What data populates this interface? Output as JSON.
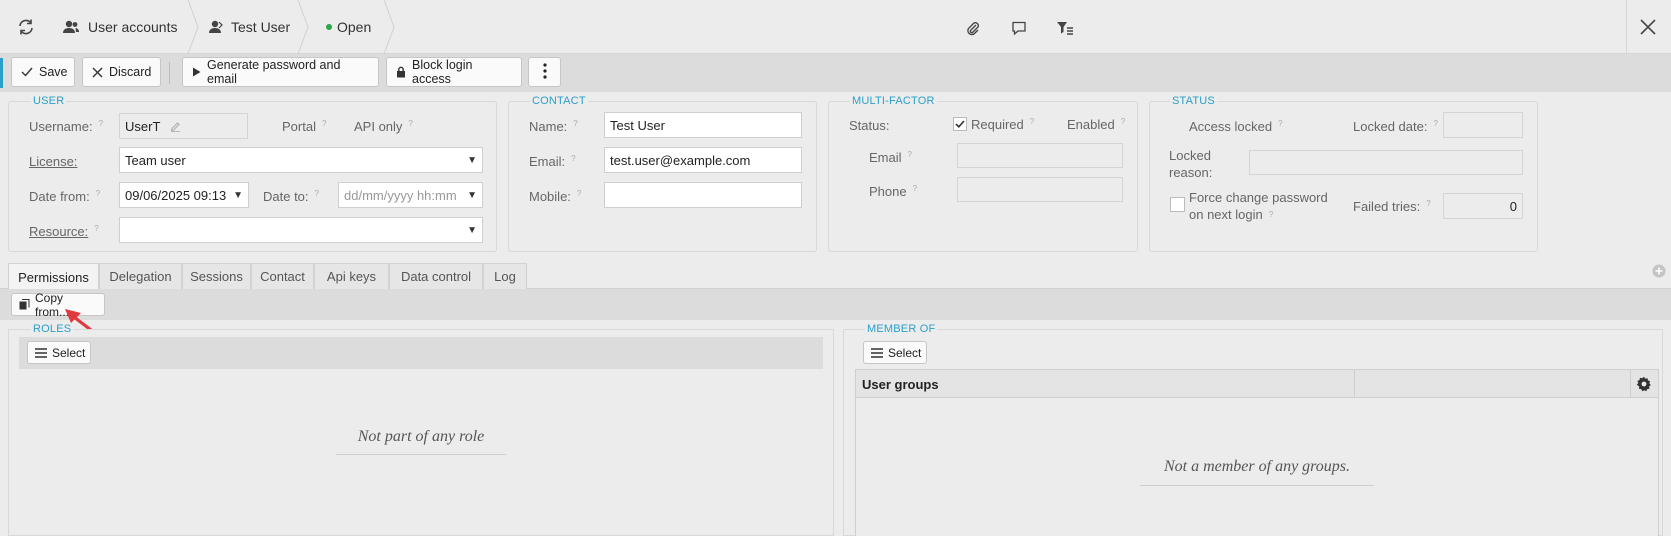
{
  "header": {
    "breadcrumbs": [
      {
        "label": "User accounts"
      },
      {
        "label": "Test User"
      },
      {
        "label": "Open"
      }
    ],
    "status_color": "#2aa845",
    "icons": [
      "refresh-icon",
      "user-accounts-icon",
      "user-icon",
      "status-dot-icon",
      "paperclip-icon",
      "comment-icon",
      "filter-list-icon",
      "close-icon"
    ]
  },
  "toolbar": {
    "save_label": "Save",
    "discard_label": "Discard",
    "generate_label": "Generate password and email",
    "block_label": "Block login access"
  },
  "user": {
    "title": "USER",
    "username_label": "Username:",
    "username_value": "UserT",
    "portal_label": "Portal",
    "api_only_label": "API only",
    "license_label": "License:",
    "license_value": "Team user",
    "date_from_label": "Date from:",
    "date_from_value": "09/06/2025 09:13",
    "date_to_label": "Date to:",
    "date_to_placeholder": "dd/mm/yyyy hh:mm",
    "resource_label": "Resource:",
    "resource_value": ""
  },
  "contact": {
    "title": "CONTACT",
    "name_label": "Name:",
    "name_value": "Test User",
    "email_label": "Email:",
    "email_value": "test.user@example.com",
    "mobile_label": "Mobile:",
    "mobile_value": ""
  },
  "mfa": {
    "title": "MULTI-FACTOR",
    "status_label": "Status:",
    "required_label": "Required",
    "required_checked": true,
    "enabled_label": "Enabled",
    "email_label": "Email",
    "phone_label": "Phone"
  },
  "status": {
    "title": "STATUS",
    "access_locked_label": "Access locked",
    "locked_date_label": "Locked date:",
    "locked_reason_label_1": "Locked",
    "locked_reason_label_2": "reason:",
    "force_change_label_1": "Force change password",
    "force_change_label_2": "on next login",
    "failed_tries_label": "Failed tries:",
    "failed_tries_value": "0"
  },
  "tabs": [
    {
      "label": "Permissions"
    },
    {
      "label": "Delegation"
    },
    {
      "label": "Sessions"
    },
    {
      "label": "Contact"
    },
    {
      "label": "Api keys"
    },
    {
      "label": "Data control"
    },
    {
      "label": "Log"
    }
  ],
  "permissions": {
    "copy_from_label": "Copy from...",
    "roles_title": "ROLES",
    "roles_select_label": "Select",
    "roles_empty": "Not part of any role",
    "member_title": "MEMBER OF",
    "member_select_label": "Select",
    "member_column": "User groups",
    "member_empty": "Not a member of any groups."
  },
  "colors": {
    "accent": "#2aa0c8",
    "annotation_arrow": "#e0393e"
  }
}
